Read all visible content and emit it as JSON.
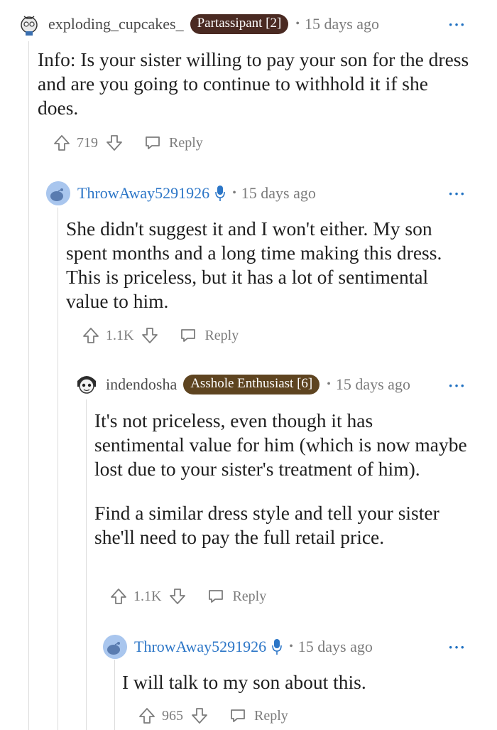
{
  "comments": [
    {
      "username": "exploding_cupcakes_",
      "flair": "Partassipant [2]",
      "flair_color": "#4a2a22",
      "time": "15 days ago",
      "text": [
        "Info: Is your sister willing to pay your son for the dress and are you going to continue to withhold it if she does."
      ],
      "votes": "719",
      "reply_label": "Reply",
      "avatar_icon": "snoo-avatar-icon"
    },
    {
      "username": "ThrowAway5291926",
      "op_badge": "mic-icon",
      "time": "15 days ago",
      "text": [
        "She didn't suggest it and I won't either. My son spent months and a long time making this dress. This is priceless, but it has a lot of sentimental value to him."
      ],
      "votes": "1.1K",
      "reply_label": "Reply",
      "avatar_icon": "default-avatar-icon"
    },
    {
      "username": "indendosha",
      "flair": "Asshole Enthusiast [6]",
      "flair_color": "#5e4420",
      "time": "15 days ago",
      "text": [
        "It's not priceless, even though it has sentimental value for him (which is now maybe lost due to your sister's treatment of him).",
        "Find a similar dress style and tell your sister she'll need to pay the full retail price."
      ],
      "votes": "1.1K",
      "reply_label": "Reply",
      "avatar_icon": "snoo-avatar-icon"
    },
    {
      "username": "ThrowAway5291926",
      "op_badge": "mic-icon",
      "time": "15 days ago",
      "text": [
        "I will talk to my son about this."
      ],
      "votes": "965",
      "reply_label": "Reply",
      "avatar_icon": "default-avatar-icon"
    }
  ],
  "separator": "•",
  "more_label": "···",
  "colors": {
    "link_blue": "#2c76c7",
    "meta_gray": "#7c7c7c",
    "thread_line": "#dcdcdc"
  }
}
